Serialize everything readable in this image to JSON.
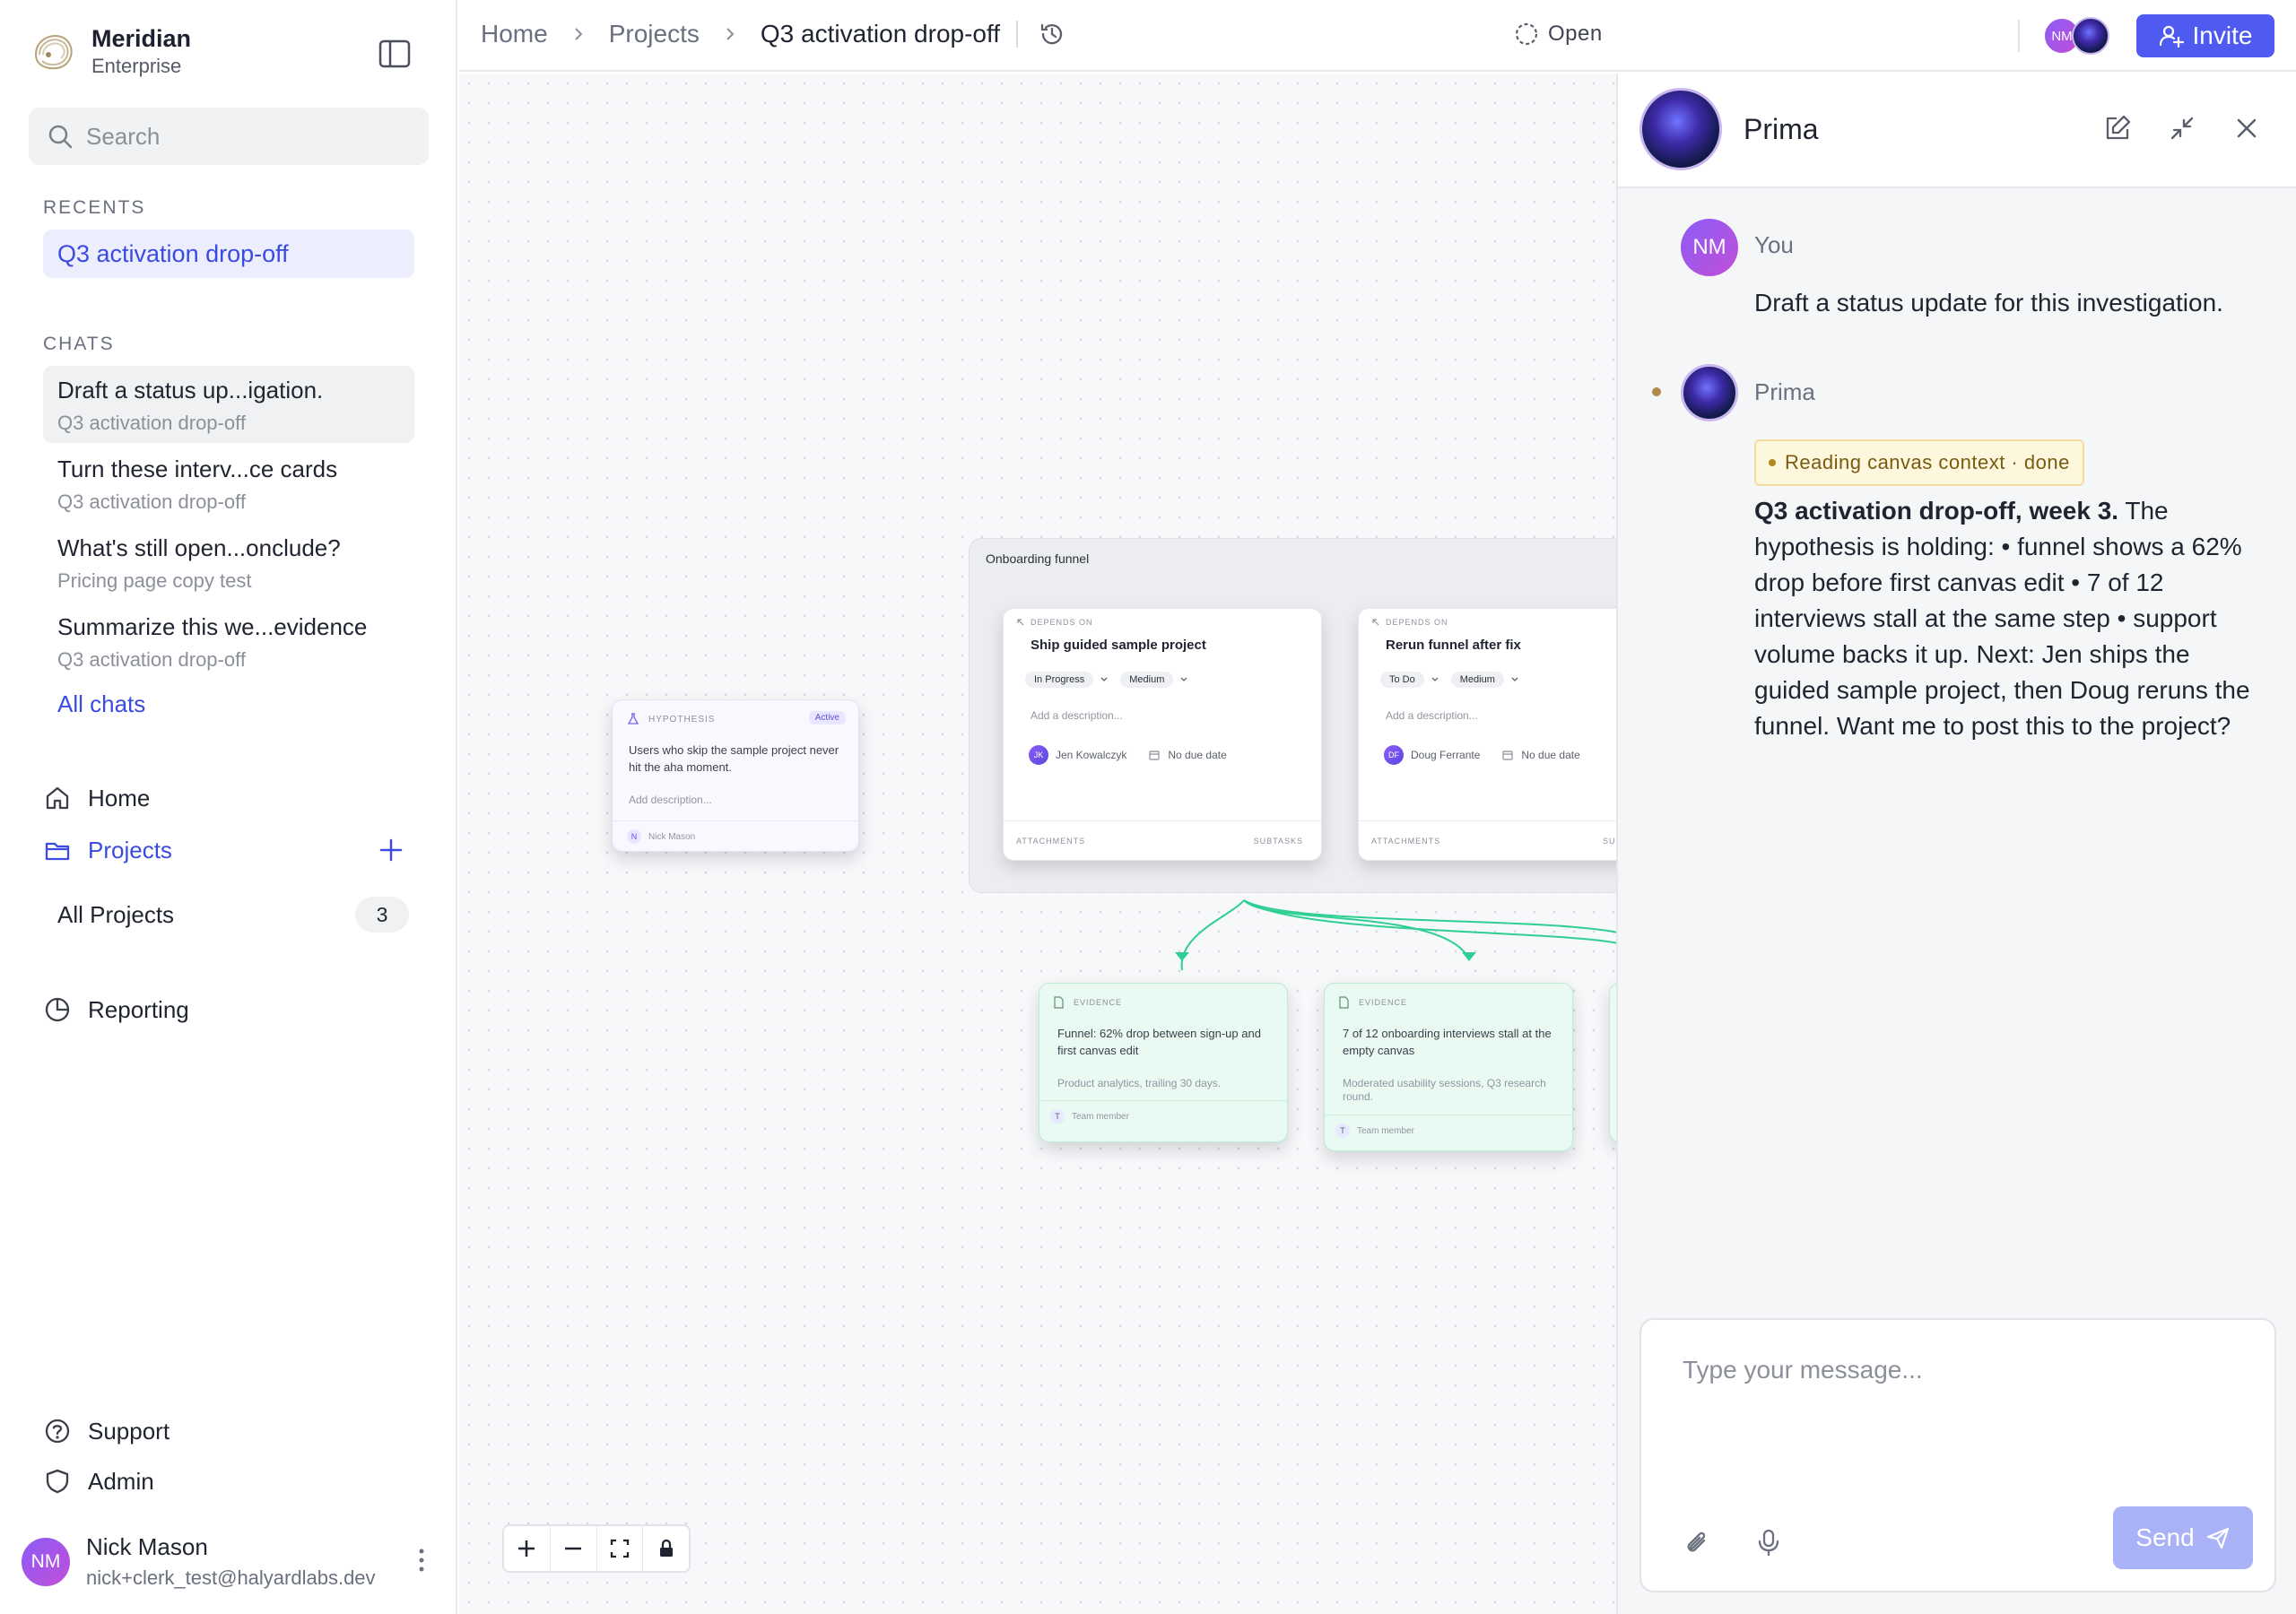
{
  "workspace": {
    "name": "Meridian",
    "plan": "Enterprise"
  },
  "search": {
    "placeholder": "Search"
  },
  "recents": {
    "label": "RECENTS",
    "items": [
      {
        "label": "Q3 activation drop-off"
      }
    ]
  },
  "chats": {
    "label": "CHATS",
    "items": [
      {
        "title": "Draft a status up...igation.",
        "project": "Q3 activation drop-off"
      },
      {
        "title": "Turn these interv...ce cards",
        "project": "Q3 activation drop-off"
      },
      {
        "title": "What's still open...onclude?",
        "project": "Pricing page copy test"
      },
      {
        "title": "Summarize this we...evidence",
        "project": "Q3 activation drop-off"
      }
    ],
    "all_label": "All chats"
  },
  "nav": {
    "home": "Home",
    "projects": "Projects",
    "all_projects": "All Projects",
    "all_projects_count": "3",
    "reporting": "Reporting",
    "support": "Support",
    "admin": "Admin"
  },
  "user": {
    "initials": "NM",
    "name": "Nick Mason",
    "email": "nick+clerk_test@halyardlabs.dev"
  },
  "breadcrumb": {
    "home": "Home",
    "projects": "Projects",
    "current": "Q3 activation drop-off"
  },
  "status": {
    "label": "Open"
  },
  "header": {
    "invite_label": "Invite",
    "avatar_initials": "NM"
  },
  "canvas": {
    "hypothesis": {
      "tag": "HYPOTHESIS",
      "badge": "Active",
      "text": "Users who skip the sample project never hit the aha moment.",
      "description_placeholder": "Add description...",
      "owner_initial": "N",
      "owner": "Nick Mason"
    },
    "group": {
      "label": "Onboarding funnel",
      "tasks": [
        {
          "depends": "DEPENDS ON",
          "title": "Ship guided sample project",
          "status": "In Progress",
          "priority": "Medium",
          "description_placeholder": "Add a description...",
          "assignee_initials": "JK",
          "assignee": "Jen Kowalczyk",
          "due": "No due date",
          "attachments": "ATTACHMENTS",
          "subtasks": "SUBTASKS"
        },
        {
          "depends": "DEPENDS ON",
          "title": "Rerun funnel after fix",
          "status": "To Do",
          "priority": "Medium",
          "description_placeholder": "Add a description...",
          "assignee_initials": "DF",
          "assignee": "Doug Ferrante",
          "due": "No due date",
          "attachments": "ATTACHMENTS",
          "subtasks": "SU"
        }
      ]
    },
    "evidence": [
      {
        "tag": "EVIDENCE",
        "title": "Funnel: 62% drop between sign-up and first canvas edit",
        "source": "Product analytics, trailing 30 days.",
        "author_initial": "T",
        "author": "Team member"
      },
      {
        "tag": "EVIDENCE",
        "title": "7 of 12 onboarding interviews stall at the empty canvas",
        "source": "Moderated usability sessions, Q3 research round.",
        "author_initial": "T",
        "author": "Team member"
      }
    ]
  },
  "assistant_panel": {
    "name": "Prima",
    "messages": [
      {
        "author": "You",
        "initials": "NM",
        "text": "Draft a status update for this investigation."
      },
      {
        "author": "Prima",
        "tool": "Reading canvas context · done",
        "lead": "Q3 activation drop-off, week 3.",
        "text": " The hypothesis is holding: • funnel shows a 62% drop before first canvas edit • 7 of 12 interviews stall at the same step • support volume backs it up. Next: Jen ships the guided sample project, then Doug reruns the funnel. Want me to post this to the project?"
      }
    ],
    "composer": {
      "placeholder": "Type your message...",
      "send_label": "Send"
    }
  },
  "colors": {
    "accent": "#4f5bf0",
    "evidence": "#e9faf3",
    "connector": "#2fcf93",
    "tool_pill": "#fdf7dd"
  }
}
